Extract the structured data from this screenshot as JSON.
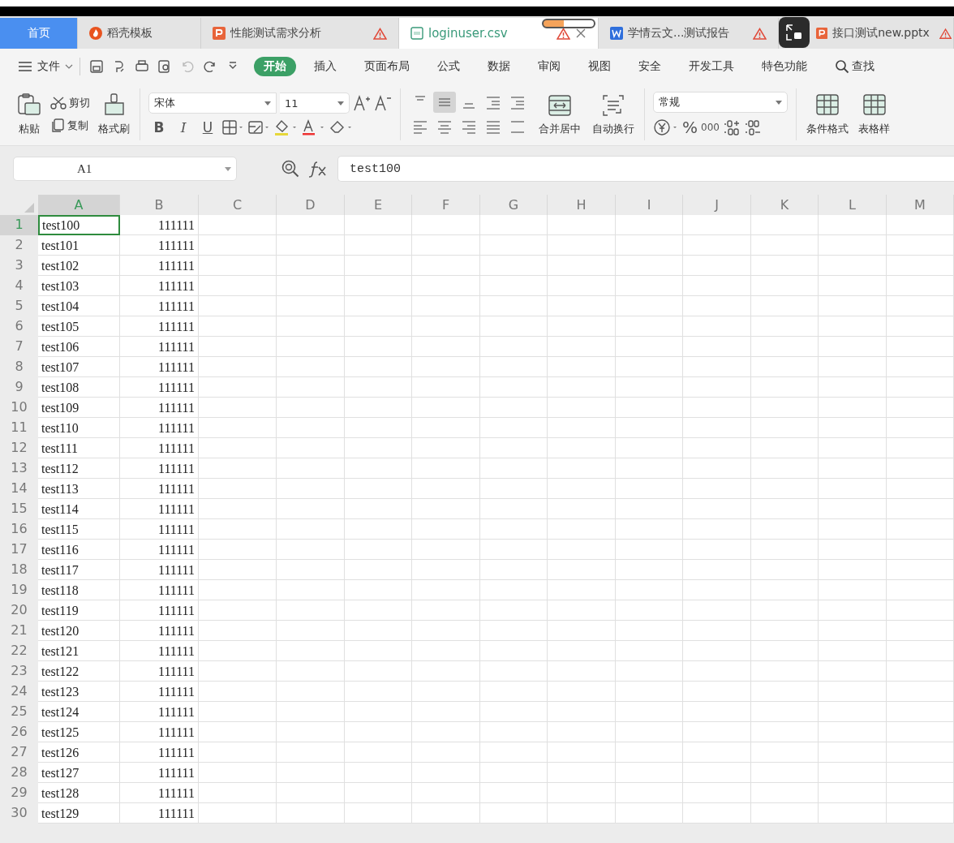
{
  "tabs": [
    {
      "label": "首页",
      "kind": "home",
      "selected": false,
      "warning": false
    },
    {
      "label": "稻壳模板",
      "kind": "flame",
      "selected": false,
      "warning": false
    },
    {
      "label": "性能测试需求分析",
      "kind": "slides",
      "selected": false,
      "warning": true
    },
    {
      "label": "loginuser.csv",
      "kind": "csv",
      "selected": true,
      "warning": true
    },
    {
      "label": "学情云文...测试报告",
      "kind": "word",
      "selected": false,
      "warning": true
    },
    {
      "label": "接口测试new.pptx",
      "kind": "slides",
      "selected": false,
      "warning": true
    }
  ],
  "menu": {
    "file": "文件",
    "items": [
      {
        "label": "开始",
        "selected": true
      },
      {
        "label": "插入",
        "selected": false
      },
      {
        "label": "页面布局",
        "selected": false
      },
      {
        "label": "公式",
        "selected": false
      },
      {
        "label": "数据",
        "selected": false
      },
      {
        "label": "审阅",
        "selected": false
      },
      {
        "label": "视图",
        "selected": false
      },
      {
        "label": "安全",
        "selected": false
      },
      {
        "label": "开发工具",
        "selected": false
      },
      {
        "label": "特色功能",
        "selected": false
      }
    ],
    "search": "查找"
  },
  "ribbon": {
    "paste": "粘贴",
    "cut": "剪切",
    "copy": "复制",
    "format_painter": "格式刷",
    "font": "宋体",
    "font_size": "11",
    "format_buttons": [
      "B",
      "I",
      "U"
    ],
    "merge": "合并居中",
    "wrap": "自动换行",
    "number_format": "常规",
    "percent": "%",
    "thousands": "000",
    "conditional_format": "条件格式",
    "table_style": "表格样"
  },
  "formula_bar": {
    "name_box": "A1",
    "formula": "test100"
  },
  "sheet": {
    "columns": [
      {
        "label": "A",
        "selected": true
      },
      {
        "label": "B",
        "selected": false
      },
      {
        "label": "C",
        "selected": false
      },
      {
        "label": "D",
        "selected": false
      },
      {
        "label": "E",
        "selected": false
      },
      {
        "label": "F",
        "selected": false
      },
      {
        "label": "G",
        "selected": false
      },
      {
        "label": "H",
        "selected": false
      },
      {
        "label": "I",
        "selected": false
      },
      {
        "label": "J",
        "selected": false
      },
      {
        "label": "K",
        "selected": false
      },
      {
        "label": "L",
        "selected": false
      },
      {
        "label": "M",
        "selected": false
      }
    ],
    "rows": [
      {
        "number": "1",
        "cells": [
          "test100",
          "111111"
        ],
        "selected": true
      },
      {
        "number": "2",
        "cells": [
          "test101",
          "111111"
        ],
        "selected": false
      },
      {
        "number": "3",
        "cells": [
          "test102",
          "111111"
        ],
        "selected": false
      },
      {
        "number": "4",
        "cells": [
          "test103",
          "111111"
        ],
        "selected": false
      },
      {
        "number": "5",
        "cells": [
          "test104",
          "111111"
        ],
        "selected": false
      },
      {
        "number": "6",
        "cells": [
          "test105",
          "111111"
        ],
        "selected": false
      },
      {
        "number": "7",
        "cells": [
          "test106",
          "111111"
        ],
        "selected": false
      },
      {
        "number": "8",
        "cells": [
          "test107",
          "111111"
        ],
        "selected": false
      },
      {
        "number": "9",
        "cells": [
          "test108",
          "111111"
        ],
        "selected": false
      },
      {
        "number": "10",
        "cells": [
          "test109",
          "111111"
        ],
        "selected": false
      },
      {
        "number": "11",
        "cells": [
          "test110",
          "111111"
        ],
        "selected": false
      },
      {
        "number": "12",
        "cells": [
          "test111",
          "111111"
        ],
        "selected": false
      },
      {
        "number": "13",
        "cells": [
          "test112",
          "111111"
        ],
        "selected": false
      },
      {
        "number": "14",
        "cells": [
          "test113",
          "111111"
        ],
        "selected": false
      },
      {
        "number": "15",
        "cells": [
          "test114",
          "111111"
        ],
        "selected": false
      },
      {
        "number": "16",
        "cells": [
          "test115",
          "111111"
        ],
        "selected": false
      },
      {
        "number": "17",
        "cells": [
          "test116",
          "111111"
        ],
        "selected": false
      },
      {
        "number": "18",
        "cells": [
          "test117",
          "111111"
        ],
        "selected": false
      },
      {
        "number": "19",
        "cells": [
          "test118",
          "111111"
        ],
        "selected": false
      },
      {
        "number": "20",
        "cells": [
          "test119",
          "111111"
        ],
        "selected": false
      },
      {
        "number": "21",
        "cells": [
          "test120",
          "111111"
        ],
        "selected": false
      },
      {
        "number": "22",
        "cells": [
          "test121",
          "111111"
        ],
        "selected": false
      },
      {
        "number": "23",
        "cells": [
          "test122",
          "111111"
        ],
        "selected": false
      },
      {
        "number": "24",
        "cells": [
          "test123",
          "111111"
        ],
        "selected": false
      },
      {
        "number": "25",
        "cells": [
          "test124",
          "111111"
        ],
        "selected": false
      },
      {
        "number": "26",
        "cells": [
          "test125",
          "111111"
        ],
        "selected": false
      },
      {
        "number": "27",
        "cells": [
          "test126",
          "111111"
        ],
        "selected": false
      },
      {
        "number": "28",
        "cells": [
          "test127",
          "111111"
        ],
        "selected": false
      },
      {
        "number": "29",
        "cells": [
          "test128",
          "111111"
        ],
        "selected": false
      },
      {
        "number": "30",
        "cells": [
          "test129",
          "111111"
        ],
        "selected": false
      }
    ]
  }
}
